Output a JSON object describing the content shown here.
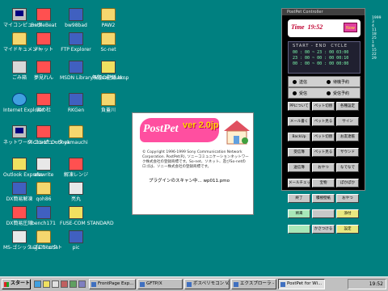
{
  "desktop_icons": [
    {
      "id": "mycomputer",
      "label": "マイコンピュータ",
      "icon": "pc-icon"
    },
    {
      "id": "battlebeat",
      "label": "BattleBeat",
      "icon": "app-icon"
    },
    {
      "id": "bw98bad",
      "label": "bw98bad",
      "icon": "app-icon"
    },
    {
      "id": "paw2",
      "label": "PAW2",
      "icon": "folder-icon"
    },
    {
      "id": "mydocs",
      "label": "マイドキュメント",
      "icon": "folder-icon"
    },
    {
      "id": "chat",
      "label": "チャット",
      "icon": "app-icon"
    },
    {
      "id": "ftp",
      "label": "FTP Explorer",
      "icon": "app-icon"
    },
    {
      "id": "sc",
      "label": "Sc-net",
      "icon": "folder-icon"
    },
    {
      "id": "trash",
      "label": "ごみ箱",
      "icon": "trash-icon"
    },
    {
      "id": "yumemi",
      "label": "夢見れん",
      "icon": "app-icon"
    },
    {
      "id": "msdn",
      "label": "MSDN Library Visual Stud...",
      "icon": "app-icon"
    },
    {
      "id": "bmp",
      "label": "無題の壁紙.bmp",
      "icon": "app-icon"
    },
    {
      "id": "ie",
      "label": "Internet Explorer",
      "icon": "globe-icon"
    },
    {
      "id": "miyako",
      "label": "宮の杜",
      "icon": "app-icon"
    },
    {
      "id": "rkgen",
      "label": "RKGen",
      "icon": "app-icon"
    },
    {
      "id": "fuki",
      "label": "負蓋川",
      "icon": "folder-icon"
    },
    {
      "id": "network",
      "label": "ネットワーク コンピュータ",
      "icon": "pc-icon"
    },
    {
      "id": "msoutlook",
      "label": "Microsoft Outlook",
      "icon": "app-icon"
    },
    {
      "id": "yamauchi",
      "label": "yamauchi",
      "icon": "folder-icon"
    },
    {
      "id": "outlookexp",
      "label": "Outlook Express",
      "icon": "app-icon"
    },
    {
      "id": "afewrite",
      "label": "afewrite",
      "icon": "app-icon"
    },
    {
      "id": "kaisou",
      "label": "解凍レンジ",
      "icon": "app-icon"
    },
    {
      "id": "dxkaito",
      "label": "DX簡易解凍",
      "icon": "app-icon"
    },
    {
      "id": "qoh86",
      "label": "qoh86",
      "icon": "folder-icon"
    },
    {
      "id": "kaeru",
      "label": "亮丸",
      "icon": "app-icon"
    },
    {
      "id": "dxasshuku",
      "label": "DX簡易圧縮",
      "icon": "app-icon"
    },
    {
      "id": "bench171",
      "label": "bench171",
      "icon": "app-icon"
    },
    {
      "id": "fuse",
      "label": "FUSE-COM STANDARD",
      "icon": "app-icon"
    },
    {
      "id": "msgothic",
      "label": "MS-ゴシック プロジェクト",
      "icon": "app-icon"
    },
    {
      "id": "saga",
      "label": "saga frontia",
      "icon": "folder-icon"
    },
    {
      "id": "pic",
      "label": "pic",
      "icon": "app-icon"
    }
  ],
  "splash": {
    "logo": "PostPet",
    "version": "ver 2.0jp",
    "copyright": "© Copyright 1996-1999 Sony Communication Network Corporation. PostPet(R), ソニーコミュニケーションネットワーク株式会社の登録商標です。So-net、ソネット、及びSo-netのロゴは、ソニー株式会社の登録商標です。",
    "loading": "プラグインのスキャン中... wp011.pmo"
  },
  "postpet_panel": {
    "title": "PostPet Controller",
    "time_label": "Time",
    "time_value": "19:52",
    "now_button": "Now",
    "cycle_header": [
      "START",
      "END",
      "CYCLE"
    ],
    "cycle_rows": [
      "00 : 00 ~ 23 : 00   03:00",
      "23 : 00 ~ 00 : 00   00:10",
      "00 : 00 ~ 00 : 00   00:00"
    ],
    "mode_rows": [
      {
        "left": "送信",
        "right": "待機予約"
      },
      {
        "left": "受信",
        "right": "受信予約"
      }
    ],
    "buttons": [
      "PPについて",
      "ペット切替",
      "各種設定",
      "メール書く",
      "ペット見る",
      "サイン",
      "BackUp",
      "ペット切替",
      "お友達帳",
      "受信簿",
      "ペット見る",
      "サウンド",
      "送信簿",
      "おやつ",
      "なでなで",
      "メールチェック",
      "宝物",
      "ぽかぽか",
      "終了",
      "積極壁紙",
      "おやつ",
      "将来",
      "",
      "添付",
      "",
      "かさつける",
      "設定"
    ]
  },
  "right_scraps": [
    "1999",
    "3",
    "4",
    "11",
    "18",
    "25",
    "1",
    "8",
    "15",
    "22",
    "29"
  ],
  "taskbar": {
    "start_label": "スタート",
    "buttons": [
      "FrontPage Exp...",
      "GFTP/X",
      "ボスペリモコン V.",
      "エクスプローラ - ...",
      "PostPet for Wi..."
    ],
    "active_index": 4,
    "clock": "19:52"
  }
}
